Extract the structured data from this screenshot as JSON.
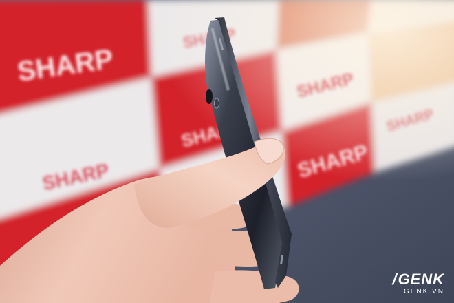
{
  "backdrop": {
    "brand_text": "SHARP",
    "colors": {
      "red": "#d3202c",
      "white": "#ece9ea",
      "floor": "#545b72"
    }
  },
  "watermark": {
    "logo": "GENK",
    "domain": "GENK.VN"
  }
}
